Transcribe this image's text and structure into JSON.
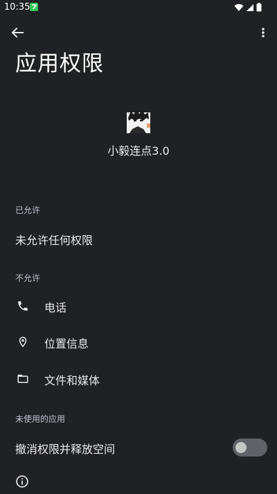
{
  "status_bar": {
    "time": "10:35"
  },
  "header": {
    "title": "应用权限"
  },
  "app": {
    "name": "小毅连点3.0"
  },
  "sections": {
    "allowed": {
      "header": "已允许",
      "empty_text": "未允许任何权限"
    },
    "denied": {
      "header": "不允许",
      "items": [
        {
          "label": "电话",
          "icon": "phone-icon"
        },
        {
          "label": "位置信息",
          "icon": "location-icon"
        },
        {
          "label": "文件和媒体",
          "icon": "folder-icon"
        }
      ]
    },
    "unused": {
      "header": "未使用的应用",
      "toggle_label": "撤消权限并释放空间",
      "toggle_on": false
    }
  },
  "colors": {
    "background": "#202124",
    "section_header": "#bcc5d0",
    "toggle_track_off": "#5f6368"
  }
}
